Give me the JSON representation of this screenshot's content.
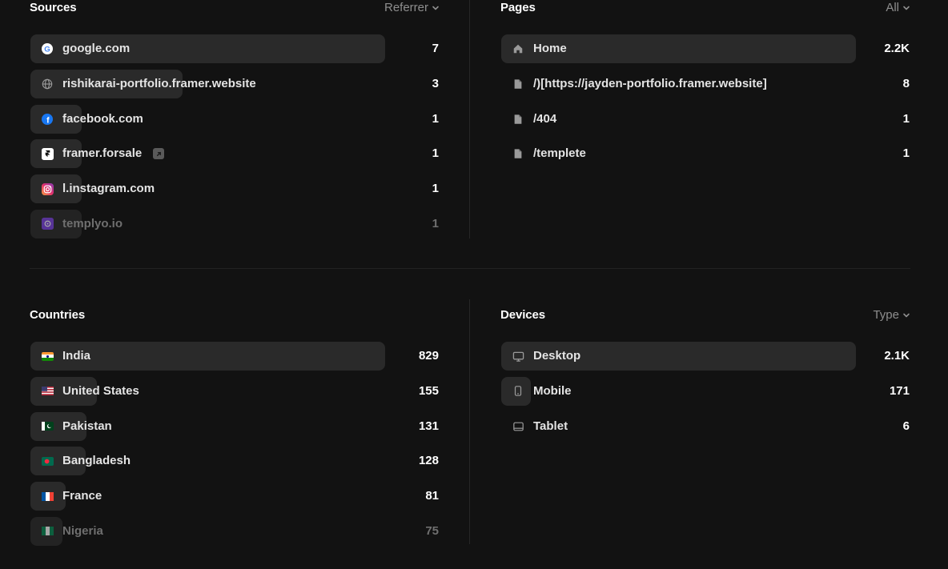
{
  "sources": {
    "title": "Sources",
    "filter": "Referrer",
    "rows": [
      {
        "label": "google.com",
        "value": "7",
        "icon": "google-icon",
        "share": 1.0
      },
      {
        "label": "rishikarai-portfolio.framer.website",
        "value": "3",
        "icon": "globe-icon",
        "share": 0.43
      },
      {
        "label": "facebook.com",
        "value": "1",
        "icon": "facebook-icon",
        "share": 0.14
      },
      {
        "label": "framer.forsale",
        "value": "1",
        "icon": "framer-icon",
        "share": 0.14
      },
      {
        "label": "l.instagram.com",
        "value": "1",
        "icon": "instagram-icon",
        "share": 0.14
      },
      {
        "label": "templyo.io",
        "value": "1",
        "icon": "templyo-icon",
        "share": 0.14
      }
    ]
  },
  "pages": {
    "title": "Pages",
    "filter": "All",
    "rows": [
      {
        "label": "Home",
        "value": "2.2K",
        "icon": "home-icon",
        "share": 1.0
      },
      {
        "label": "/)[https://jayden-portfolio.framer.website]",
        "value": "8",
        "icon": "file-icon",
        "share": 0.0
      },
      {
        "label": "/404",
        "value": "1",
        "icon": "file-icon",
        "share": 0.0
      },
      {
        "label": "/templete",
        "value": "1",
        "icon": "file-icon",
        "share": 0.0
      }
    ]
  },
  "countries": {
    "title": "Countries",
    "rows": [
      {
        "label": "India",
        "value": "829",
        "icon": "india-flag-icon",
        "share": 1.0
      },
      {
        "label": "United States",
        "value": "155",
        "icon": "us-flag-icon",
        "share": 0.19
      },
      {
        "label": "Pakistan",
        "value": "131",
        "icon": "pakistan-flag-icon",
        "share": 0.16
      },
      {
        "label": "Bangladesh",
        "value": "128",
        "icon": "bangladesh-flag-icon",
        "share": 0.155
      },
      {
        "label": "France",
        "value": "81",
        "icon": "france-flag-icon",
        "share": 0.1
      },
      {
        "label": "Nigeria",
        "value": "75",
        "icon": "nigeria-flag-icon",
        "share": 0.09
      }
    ]
  },
  "devices": {
    "title": "Devices",
    "filter": "Type",
    "rows": [
      {
        "label": "Desktop",
        "value": "2.1K",
        "icon": "desktop-icon",
        "share": 1.0
      },
      {
        "label": "Mobile",
        "value": "171",
        "icon": "mobile-icon",
        "share": 0.085
      },
      {
        "label": "Tablet",
        "value": "6",
        "icon": "tablet-icon",
        "share": 0.0
      }
    ]
  },
  "colors": {
    "background": "#121212",
    "bar": "#2a2a2a",
    "text": "#e4e4e4",
    "muted": "#8e8e8e"
  }
}
